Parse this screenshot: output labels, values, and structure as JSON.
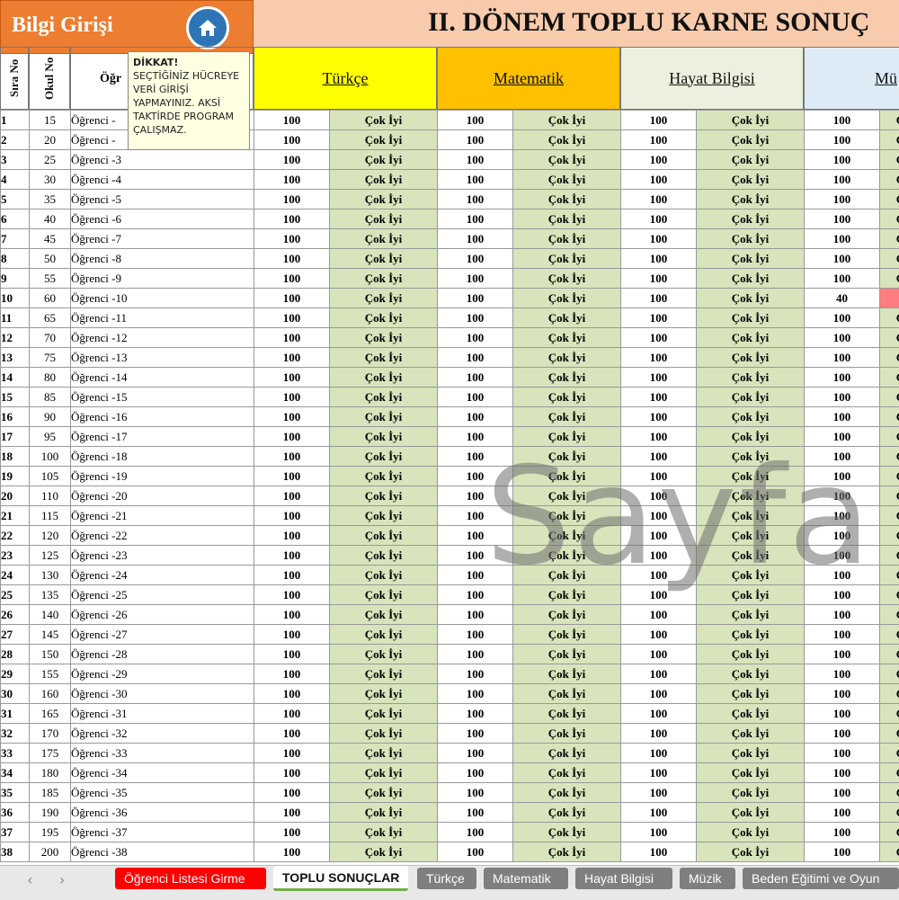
{
  "app": {
    "bilgi_label": "Bilgi Girişi",
    "home_icon": "home-icon"
  },
  "title": "II. DÖNEM TOPLU KARNE SONUÇ",
  "headers": {
    "sira": "Sıra No",
    "okul": "Okul No",
    "ogrenci": "Öğr"
  },
  "subjects": [
    {
      "label": "Türkçe",
      "color": "#ffff00"
    },
    {
      "label": "Matematik",
      "color": "#ffc000"
    },
    {
      "label": "Hayat Bilgisi",
      "color": "#ebf1de"
    },
    {
      "label": "Mü",
      "color": "#ddebf7"
    }
  ],
  "note": {
    "title": "DİKKAT!",
    "lines": [
      "SEÇTİĞİNİZ HÜCREYE",
      "VERİ GİRİŞİ",
      "YAPMAYINIZ. AKSİ",
      "TAKTİRDE PROGRAM",
      "ÇALIŞMAZ."
    ]
  },
  "grade_label": "Çok İyi",
  "rows": [
    {
      "sira": "1",
      "okul": "15",
      "ad": "Öğrenci -",
      "s": [
        "100",
        "100",
        "100",
        "100"
      ]
    },
    {
      "sira": "2",
      "okul": "20",
      "ad": "Öğrenci -",
      "s": [
        "100",
        "100",
        "100",
        "100"
      ]
    },
    {
      "sira": "3",
      "okul": "25",
      "ad": "Öğrenci -3",
      "s": [
        "100",
        "100",
        "100",
        "100"
      ]
    },
    {
      "sira": "4",
      "okul": "30",
      "ad": "Öğrenci -4",
      "s": [
        "100",
        "100",
        "100",
        "100"
      ]
    },
    {
      "sira": "5",
      "okul": "35",
      "ad": "Öğrenci -5",
      "s": [
        "100",
        "100",
        "100",
        "100"
      ]
    },
    {
      "sira": "6",
      "okul": "40",
      "ad": "Öğrenci -6",
      "s": [
        "100",
        "100",
        "100",
        "100"
      ]
    },
    {
      "sira": "7",
      "okul": "45",
      "ad": "Öğrenci -7",
      "s": [
        "100",
        "100",
        "100",
        "100"
      ]
    },
    {
      "sira": "8",
      "okul": "50",
      "ad": "Öğrenci -8",
      "s": [
        "100",
        "100",
        "100",
        "100"
      ]
    },
    {
      "sira": "9",
      "okul": "55",
      "ad": "Öğrenci -9",
      "s": [
        "100",
        "100",
        "100",
        "100"
      ]
    },
    {
      "sira": "10",
      "okul": "60",
      "ad": "Öğrenci -10",
      "s": [
        "100",
        "100",
        "100",
        "40"
      ]
    },
    {
      "sira": "11",
      "okul": "65",
      "ad": "Öğrenci -11",
      "s": [
        "100",
        "100",
        "100",
        "100"
      ]
    },
    {
      "sira": "12",
      "okul": "70",
      "ad": "Öğrenci -12",
      "s": [
        "100",
        "100",
        "100",
        "100"
      ]
    },
    {
      "sira": "13",
      "okul": "75",
      "ad": "Öğrenci -13",
      "s": [
        "100",
        "100",
        "100",
        "100"
      ]
    },
    {
      "sira": "14",
      "okul": "80",
      "ad": "Öğrenci -14",
      "s": [
        "100",
        "100",
        "100",
        "100"
      ]
    },
    {
      "sira": "15",
      "okul": "85",
      "ad": "Öğrenci -15",
      "s": [
        "100",
        "100",
        "100",
        "100"
      ]
    },
    {
      "sira": "16",
      "okul": "90",
      "ad": "Öğrenci -16",
      "s": [
        "100",
        "100",
        "100",
        "100"
      ]
    },
    {
      "sira": "17",
      "okul": "95",
      "ad": "Öğrenci -17",
      "s": [
        "100",
        "100",
        "100",
        "100"
      ]
    },
    {
      "sira": "18",
      "okul": "100",
      "ad": "Öğrenci -18",
      "s": [
        "100",
        "100",
        "100",
        "100"
      ]
    },
    {
      "sira": "19",
      "okul": "105",
      "ad": "Öğrenci -19",
      "s": [
        "100",
        "100",
        "100",
        "100"
      ]
    },
    {
      "sira": "20",
      "okul": "110",
      "ad": "Öğrenci -20",
      "s": [
        "100",
        "100",
        "100",
        "100"
      ]
    },
    {
      "sira": "21",
      "okul": "115",
      "ad": "Öğrenci -21",
      "s": [
        "100",
        "100",
        "100",
        "100"
      ]
    },
    {
      "sira": "22",
      "okul": "120",
      "ad": "Öğrenci -22",
      "s": [
        "100",
        "100",
        "100",
        "100"
      ]
    },
    {
      "sira": "23",
      "okul": "125",
      "ad": "Öğrenci -23",
      "s": [
        "100",
        "100",
        "100",
        "100"
      ]
    },
    {
      "sira": "24",
      "okul": "130",
      "ad": "Öğrenci -24",
      "s": [
        "100",
        "100",
        "100",
        "100"
      ]
    },
    {
      "sira": "25",
      "okul": "135",
      "ad": "Öğrenci -25",
      "s": [
        "100",
        "100",
        "100",
        "100"
      ]
    },
    {
      "sira": "26",
      "okul": "140",
      "ad": "Öğrenci -26",
      "s": [
        "100",
        "100",
        "100",
        "100"
      ]
    },
    {
      "sira": "27",
      "okul": "145",
      "ad": "Öğrenci -27",
      "s": [
        "100",
        "100",
        "100",
        "100"
      ]
    },
    {
      "sira": "28",
      "okul": "150",
      "ad": "Öğrenci -28",
      "s": [
        "100",
        "100",
        "100",
        "100"
      ]
    },
    {
      "sira": "29",
      "okul": "155",
      "ad": "Öğrenci -29",
      "s": [
        "100",
        "100",
        "100",
        "100"
      ]
    },
    {
      "sira": "30",
      "okul": "160",
      "ad": "Öğrenci -30",
      "s": [
        "100",
        "100",
        "100",
        "100"
      ]
    },
    {
      "sira": "31",
      "okul": "165",
      "ad": "Öğrenci -31",
      "s": [
        "100",
        "100",
        "100",
        "100"
      ]
    },
    {
      "sira": "32",
      "okul": "170",
      "ad": "Öğrenci -32",
      "s": [
        "100",
        "100",
        "100",
        "100"
      ]
    },
    {
      "sira": "33",
      "okul": "175",
      "ad": "Öğrenci -33",
      "s": [
        "100",
        "100",
        "100",
        "100"
      ]
    },
    {
      "sira": "34",
      "okul": "180",
      "ad": "Öğrenci -34",
      "s": [
        "100",
        "100",
        "100",
        "100"
      ]
    },
    {
      "sira": "35",
      "okul": "185",
      "ad": "Öğrenci -35",
      "s": [
        "100",
        "100",
        "100",
        "100"
      ]
    },
    {
      "sira": "36",
      "okul": "190",
      "ad": "Öğrenci -36",
      "s": [
        "100",
        "100",
        "100",
        "100"
      ]
    },
    {
      "sira": "37",
      "okul": "195",
      "ad": "Öğrenci -37",
      "s": [
        "100",
        "100",
        "100",
        "100"
      ]
    },
    {
      "sira": "38",
      "okul": "200",
      "ad": "Öğrenci -38",
      "s": [
        "100",
        "100",
        "100",
        "100"
      ]
    }
  ],
  "watermark": "Sayfa",
  "tabs": [
    {
      "label": "Öğrenci Listesi Girme",
      "style": "red"
    },
    {
      "label": "TOPLU SONUÇLAR",
      "style": "active"
    },
    {
      "label": "Türkçe",
      "style": "gray"
    },
    {
      "label": "Matematik",
      "style": "gray"
    },
    {
      "label": "Hayat Bilgisi",
      "style": "gray"
    },
    {
      "label": "Müzik",
      "style": "gray"
    },
    {
      "label": "Beden Eğitimi ve Oyun",
      "style": "gray"
    }
  ],
  "colors": {
    "grade_green": "#d8e4bc",
    "low_red": "#ff7c80",
    "title_band": "#f8cbad",
    "bilgi_orange": "#ed7d31"
  }
}
